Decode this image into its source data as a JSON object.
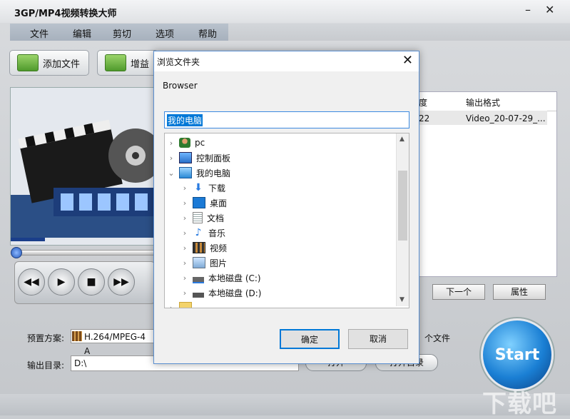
{
  "app": {
    "title": "3GP/MP4视频转换大师",
    "menu": [
      "文件",
      "编辑",
      "剪切",
      "选项",
      "帮助"
    ],
    "toolbar": {
      "add_file": "添加文件",
      "enhance": "增益"
    },
    "file_list": {
      "headers": [
        "度",
        "输出格式"
      ],
      "row": [
        "22",
        "Video_20-07-29_..."
      ]
    },
    "next_button": "下一个",
    "properties_button": "属性",
    "preset_label": "预置方案:",
    "preset_value": "H.264/MPEG-4 A",
    "output_dir_label": "输出目录:",
    "output_dir_value": "D:\\",
    "per_file_text": "个文件",
    "open_button": "打开",
    "open_dir_button": "打开目录",
    "start_button": "Start",
    "watermark": "下载吧"
  },
  "dialog": {
    "title": "浏览文件夹",
    "description": "Browser",
    "selected_path": "我的电脑",
    "tree": [
      {
        "label": "pc",
        "icon": "user-icon"
      },
      {
        "label": "控制面板",
        "icon": "control-panel-icon"
      },
      {
        "label": "我的电脑",
        "icon": "computer-icon"
      },
      {
        "label": "下载",
        "icon": "download-icon"
      },
      {
        "label": "桌面",
        "icon": "desktop-icon"
      },
      {
        "label": "文档",
        "icon": "document-icon"
      },
      {
        "label": "音乐",
        "icon": "music-icon"
      },
      {
        "label": "视频",
        "icon": "video-icon"
      },
      {
        "label": "图片",
        "icon": "picture-icon"
      },
      {
        "label": "本地磁盘 (C:)",
        "icon": "disk-c-icon"
      },
      {
        "label": "本地磁盘 (D:)",
        "icon": "disk-d-icon"
      },
      {
        "label": "",
        "icon": "folder-icon"
      }
    ],
    "ok_button": "确定",
    "cancel_button": "取消"
  }
}
